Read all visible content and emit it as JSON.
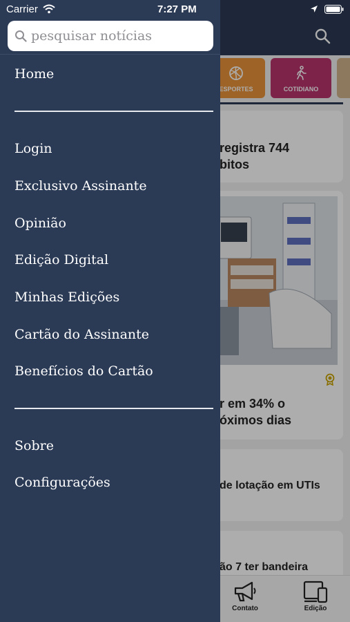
{
  "status_bar": {
    "carrier": "Carrier",
    "time": "7:27 PM"
  },
  "drawer": {
    "search_placeholder": "pesquisar notícias",
    "menu_group_1": [
      "Home"
    ],
    "menu_group_2": [
      "Login",
      "Exclusivo Assinante",
      "Opinião",
      "Edição Digital",
      "Minhas Edições",
      "Cartão do Assinante",
      "Benefícios do Cartão"
    ],
    "menu_group_3": [
      "Sobre",
      "Configurações"
    ]
  },
  "background_app": {
    "categories": [
      {
        "label": "ESPORTES",
        "color": "#e8923a"
      },
      {
        "label": "COTIDIANO",
        "color": "#b8346c"
      }
    ],
    "cards": {
      "card1_line1": "registra 744",
      "card1_line2": "bitos",
      "card2_line1": "r em 34% o",
      "card2_line2": "óximos dias",
      "card3_text": "de lotação em UTIs",
      "card4_text": "ão 7 ter bandeira"
    },
    "tabs": {
      "contato": "Contato",
      "edicao": "Edição"
    }
  },
  "colors": {
    "drawer_bg": "#2b3a55",
    "menu_text": "#ffffff",
    "dim_overlay": "rgba(0,0,0,0.32)"
  }
}
